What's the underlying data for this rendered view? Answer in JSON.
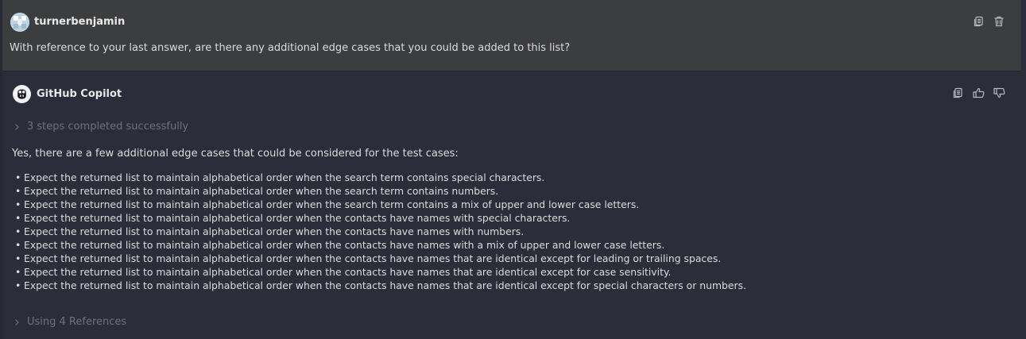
{
  "user_message": {
    "author": "turnerbenjamin",
    "text": "With reference to your last answer, are there any additional edge cases that you could be added to this list?"
  },
  "copilot_response": {
    "author": "GitHub Copilot",
    "steps_label": "3 steps completed successfully",
    "intro": "Yes, there are a few additional edge cases that could be considered for the test cases:",
    "bullet_marker": "•",
    "bullets": [
      "Expect the returned list to maintain alphabetical order when the search term contains special characters.",
      "Expect the returned list to maintain alphabetical order when the search term contains numbers.",
      "Expect the returned list to maintain alphabetical order when the search term contains a mix of upper and lower case letters.",
      "Expect the returned list to maintain alphabetical order when the contacts have names with special characters.",
      "Expect the returned list to maintain alphabetical order when the contacts have names with numbers.",
      "Expect the returned list to maintain alphabetical order when the contacts have names with a mix of upper and lower case letters.",
      "Expect the returned list to maintain alphabetical order when the contacts have names that are identical except for leading or trailing spaces.",
      "Expect the returned list to maintain alphabetical order when the contacts have names that are identical except for case sensitivity.",
      "Expect the returned list to maintain alphabetical order when the contacts have names that are identical except for special characters or numbers."
    ],
    "references_label": "Using 4 References"
  },
  "icons": {
    "user_actions": [
      "copy-icon",
      "trash-icon"
    ],
    "response_actions": [
      "copy-icon",
      "thumbs-up-icon",
      "thumbs-down-icon"
    ],
    "expand": "chevron-right-icon"
  },
  "colors": {
    "background": "#2b2d3a",
    "user_block": "#3c3d3f",
    "text": "#dcdcdc",
    "muted": "#6e717c"
  }
}
